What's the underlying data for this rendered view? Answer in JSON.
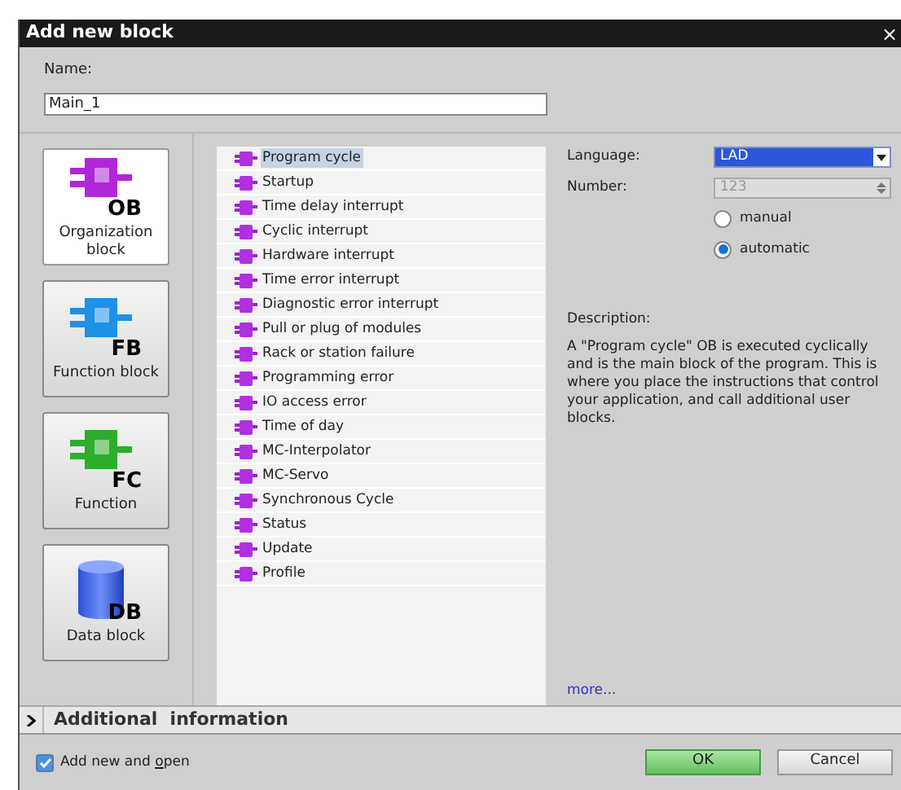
{
  "window": {
    "title": "Add new block",
    "close": "×"
  },
  "name": {
    "label": "Name:",
    "value": "Main_1"
  },
  "block_types": [
    {
      "kind": "ob",
      "tag": "OB",
      "label": "Organization block",
      "selected": true
    },
    {
      "kind": "fb",
      "tag": "FB",
      "label": "Function block",
      "selected": false
    },
    {
      "kind": "fc",
      "tag": "FC",
      "label": "Function",
      "selected": false
    },
    {
      "kind": "db",
      "tag": "DB",
      "label": "Data block",
      "selected": false
    }
  ],
  "event_classes": [
    {
      "label": "Program cycle",
      "selected": true
    },
    {
      "label": "Startup",
      "selected": false
    },
    {
      "label": "Time delay interrupt",
      "selected": false
    },
    {
      "label": "Cyclic interrupt",
      "selected": false
    },
    {
      "label": "Hardware interrupt",
      "selected": false
    },
    {
      "label": "Time error interrupt",
      "selected": false
    },
    {
      "label": "Diagnostic error interrupt",
      "selected": false
    },
    {
      "label": "Pull or plug of modules",
      "selected": false
    },
    {
      "label": "Rack or station failure",
      "selected": false
    },
    {
      "label": "Programming error",
      "selected": false
    },
    {
      "label": "IO access error",
      "selected": false
    },
    {
      "label": "Time of day",
      "selected": false
    },
    {
      "label": "MC-Interpolator",
      "selected": false
    },
    {
      "label": "MC-Servo",
      "selected": false
    },
    {
      "label": "Synchronous Cycle",
      "selected": false
    },
    {
      "label": "Status",
      "selected": false
    },
    {
      "label": "Update",
      "selected": false
    },
    {
      "label": "Profile",
      "selected": false
    }
  ],
  "language": {
    "label": "Language:",
    "value": "LAD"
  },
  "number": {
    "label": "Number:",
    "value": "123",
    "disabled": true
  },
  "numbering": [
    {
      "label": "manual",
      "selected": false
    },
    {
      "label": "automatic",
      "selected": true
    }
  ],
  "description": {
    "label": "Description:",
    "text": "A \"Program cycle\" OB is executed cyclically and is the main block of the program. This is where you place the instructions that control your application, and call additional user blocks."
  },
  "more_link": "more...",
  "additional_information": {
    "label": "Additional  information",
    "expanded": false
  },
  "add_new_and_open": {
    "label_before": "Add new and ",
    "label_key": "o",
    "label_after": "pen",
    "checked": true
  },
  "buttons": [
    {
      "kind": "primary",
      "label": "OK"
    },
    {
      "kind": "secondary",
      "label": "Cancel"
    }
  ]
}
